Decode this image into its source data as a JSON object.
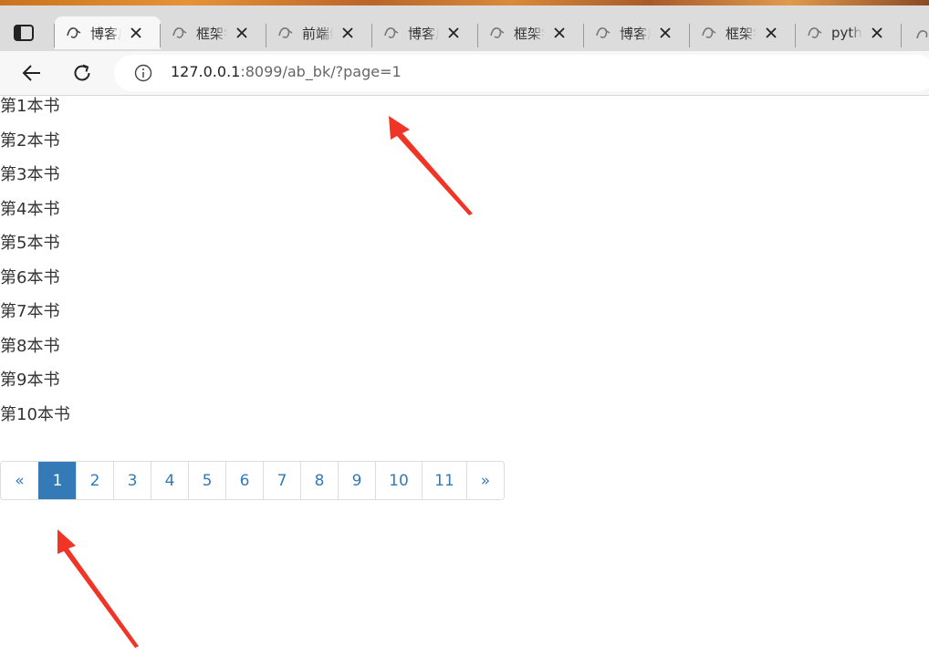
{
  "browser": {
    "tabs": [
      {
        "title": "博客后台",
        "active": true
      },
      {
        "title": "框架学习",
        "active": false
      },
      {
        "title": "前端练习",
        "active": false
      },
      {
        "title": "博客后台",
        "active": false
      },
      {
        "title": "框架学习",
        "active": false
      },
      {
        "title": "博客后台",
        "active": false
      },
      {
        "title": "框架学习",
        "active": false
      },
      {
        "title": "python",
        "active": false
      }
    ],
    "url": {
      "host": "127.0.0.1",
      "rest": ":8099/ab_bk/?page=1"
    }
  },
  "books": [
    "第1本书",
    "第2本书",
    "第3本书",
    "第4本书",
    "第5本书",
    "第6本书",
    "第7本书",
    "第8本书",
    "第9本书",
    "第10本书"
  ],
  "pagination": {
    "prev": "«",
    "pages": [
      "1",
      "2",
      "3",
      "4",
      "5",
      "6",
      "7",
      "8",
      "9",
      "10",
      "11"
    ],
    "current": "1",
    "next": "»"
  },
  "colors": {
    "accent": "#337ab7",
    "annotation": "#f03426"
  }
}
